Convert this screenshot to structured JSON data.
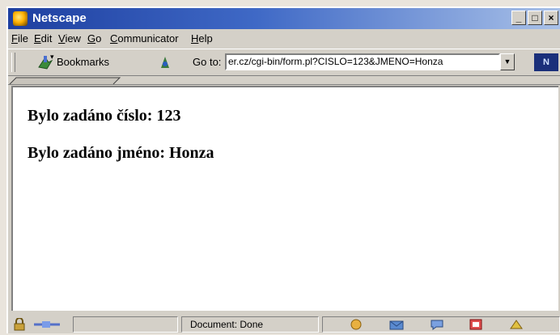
{
  "window": {
    "title": "Netscape",
    "buttons": [
      "_",
      "□",
      "×"
    ]
  },
  "menu": [
    {
      "label": "File",
      "key": "F",
      "rest": "ile"
    },
    {
      "label": "Edit",
      "key": "E",
      "rest": "dit"
    },
    {
      "label": "View",
      "key": "V",
      "rest": "iew"
    },
    {
      "label": "Go",
      "key": "G",
      "rest": "o"
    },
    {
      "label": "Communicator",
      "key": "C",
      "rest": "ommunicator"
    },
    {
      "label": "Help",
      "key": "H",
      "rest": "elp"
    }
  ],
  "toolbar": {
    "bookmarks_label": "Bookmarks",
    "goto_label": "Go to:",
    "url": "er.cz/cgi-bin/form.pl?CISLO=123&JMENO=Honza",
    "logo_text": "N"
  },
  "content": {
    "lines": [
      "Bylo zadáno číslo: 123",
      "Bylo zadáno jméno: Honza"
    ]
  },
  "status": {
    "text": "Document: Done"
  },
  "colors": {
    "titlebar_start": "#1e3fa0",
    "titlebar_end": "#a9c1e8",
    "chrome": "#d4d0c8"
  },
  "icons": [
    "netscape-icon",
    "bookmarks-icon",
    "location-icon",
    "dropdown-arrow-icon",
    "netscape-logo-icon",
    "security-lock-icon",
    "connection-icon",
    "navigator-icon",
    "mail-icon",
    "discussion-icon",
    "composer-icon",
    "aim-icon"
  ]
}
